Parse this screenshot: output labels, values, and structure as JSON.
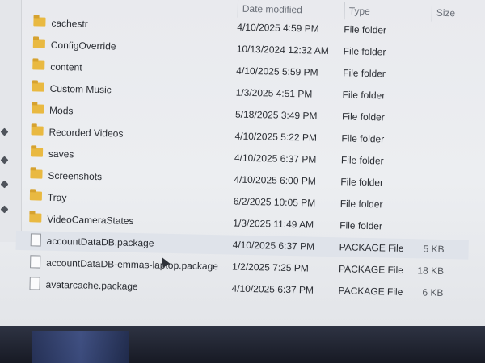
{
  "columns": {
    "date": "Date modified",
    "type": "Type",
    "size": "Size"
  },
  "files": [
    {
      "name": "cachestr",
      "date": "4/10/2025 4:59 PM",
      "type": "File folder",
      "size": "",
      "kind": "folder"
    },
    {
      "name": "ConfigOverride",
      "date": "10/13/2024 12:32 AM",
      "type": "File folder",
      "size": "",
      "kind": "folder"
    },
    {
      "name": "content",
      "date": "4/10/2025 5:59 PM",
      "type": "File folder",
      "size": "",
      "kind": "folder"
    },
    {
      "name": "Custom Music",
      "date": "1/3/2025 4:51 PM",
      "type": "File folder",
      "size": "",
      "kind": "folder"
    },
    {
      "name": "Mods",
      "date": "5/18/2025 3:49 PM",
      "type": "File folder",
      "size": "",
      "kind": "folder"
    },
    {
      "name": "Recorded Videos",
      "date": "4/10/2025 5:22 PM",
      "type": "File folder",
      "size": "",
      "kind": "folder"
    },
    {
      "name": "saves",
      "date": "4/10/2025 6:37 PM",
      "type": "File folder",
      "size": "",
      "kind": "folder"
    },
    {
      "name": "Screenshots",
      "date": "4/10/2025 6:00 PM",
      "type": "File folder",
      "size": "",
      "kind": "folder"
    },
    {
      "name": "Tray",
      "date": "6/2/2025 10:05 PM",
      "type": "File folder",
      "size": "",
      "kind": "folder"
    },
    {
      "name": "VideoCameraStates",
      "date": "1/3/2025 11:49 AM",
      "type": "File folder",
      "size": "",
      "kind": "folder"
    },
    {
      "name": "accountDataDB.package",
      "date": "4/10/2025 6:37 PM",
      "type": "PACKAGE File",
      "size": "5 KB",
      "kind": "file"
    },
    {
      "name": "accountDataDB-emmas-laptop.package",
      "date": "1/2/2025 7:25 PM",
      "type": "PACKAGE File",
      "size": "18 KB",
      "kind": "file"
    },
    {
      "name": "avatarcache.package",
      "date": "4/10/2025 6:37 PM",
      "type": "PACKAGE File",
      "size": "6 KB",
      "kind": "file"
    }
  ],
  "selected_index": 10,
  "colors": {
    "folder": "#e9b941",
    "selection": "#dfe3ea",
    "text": "#2a2d33"
  }
}
